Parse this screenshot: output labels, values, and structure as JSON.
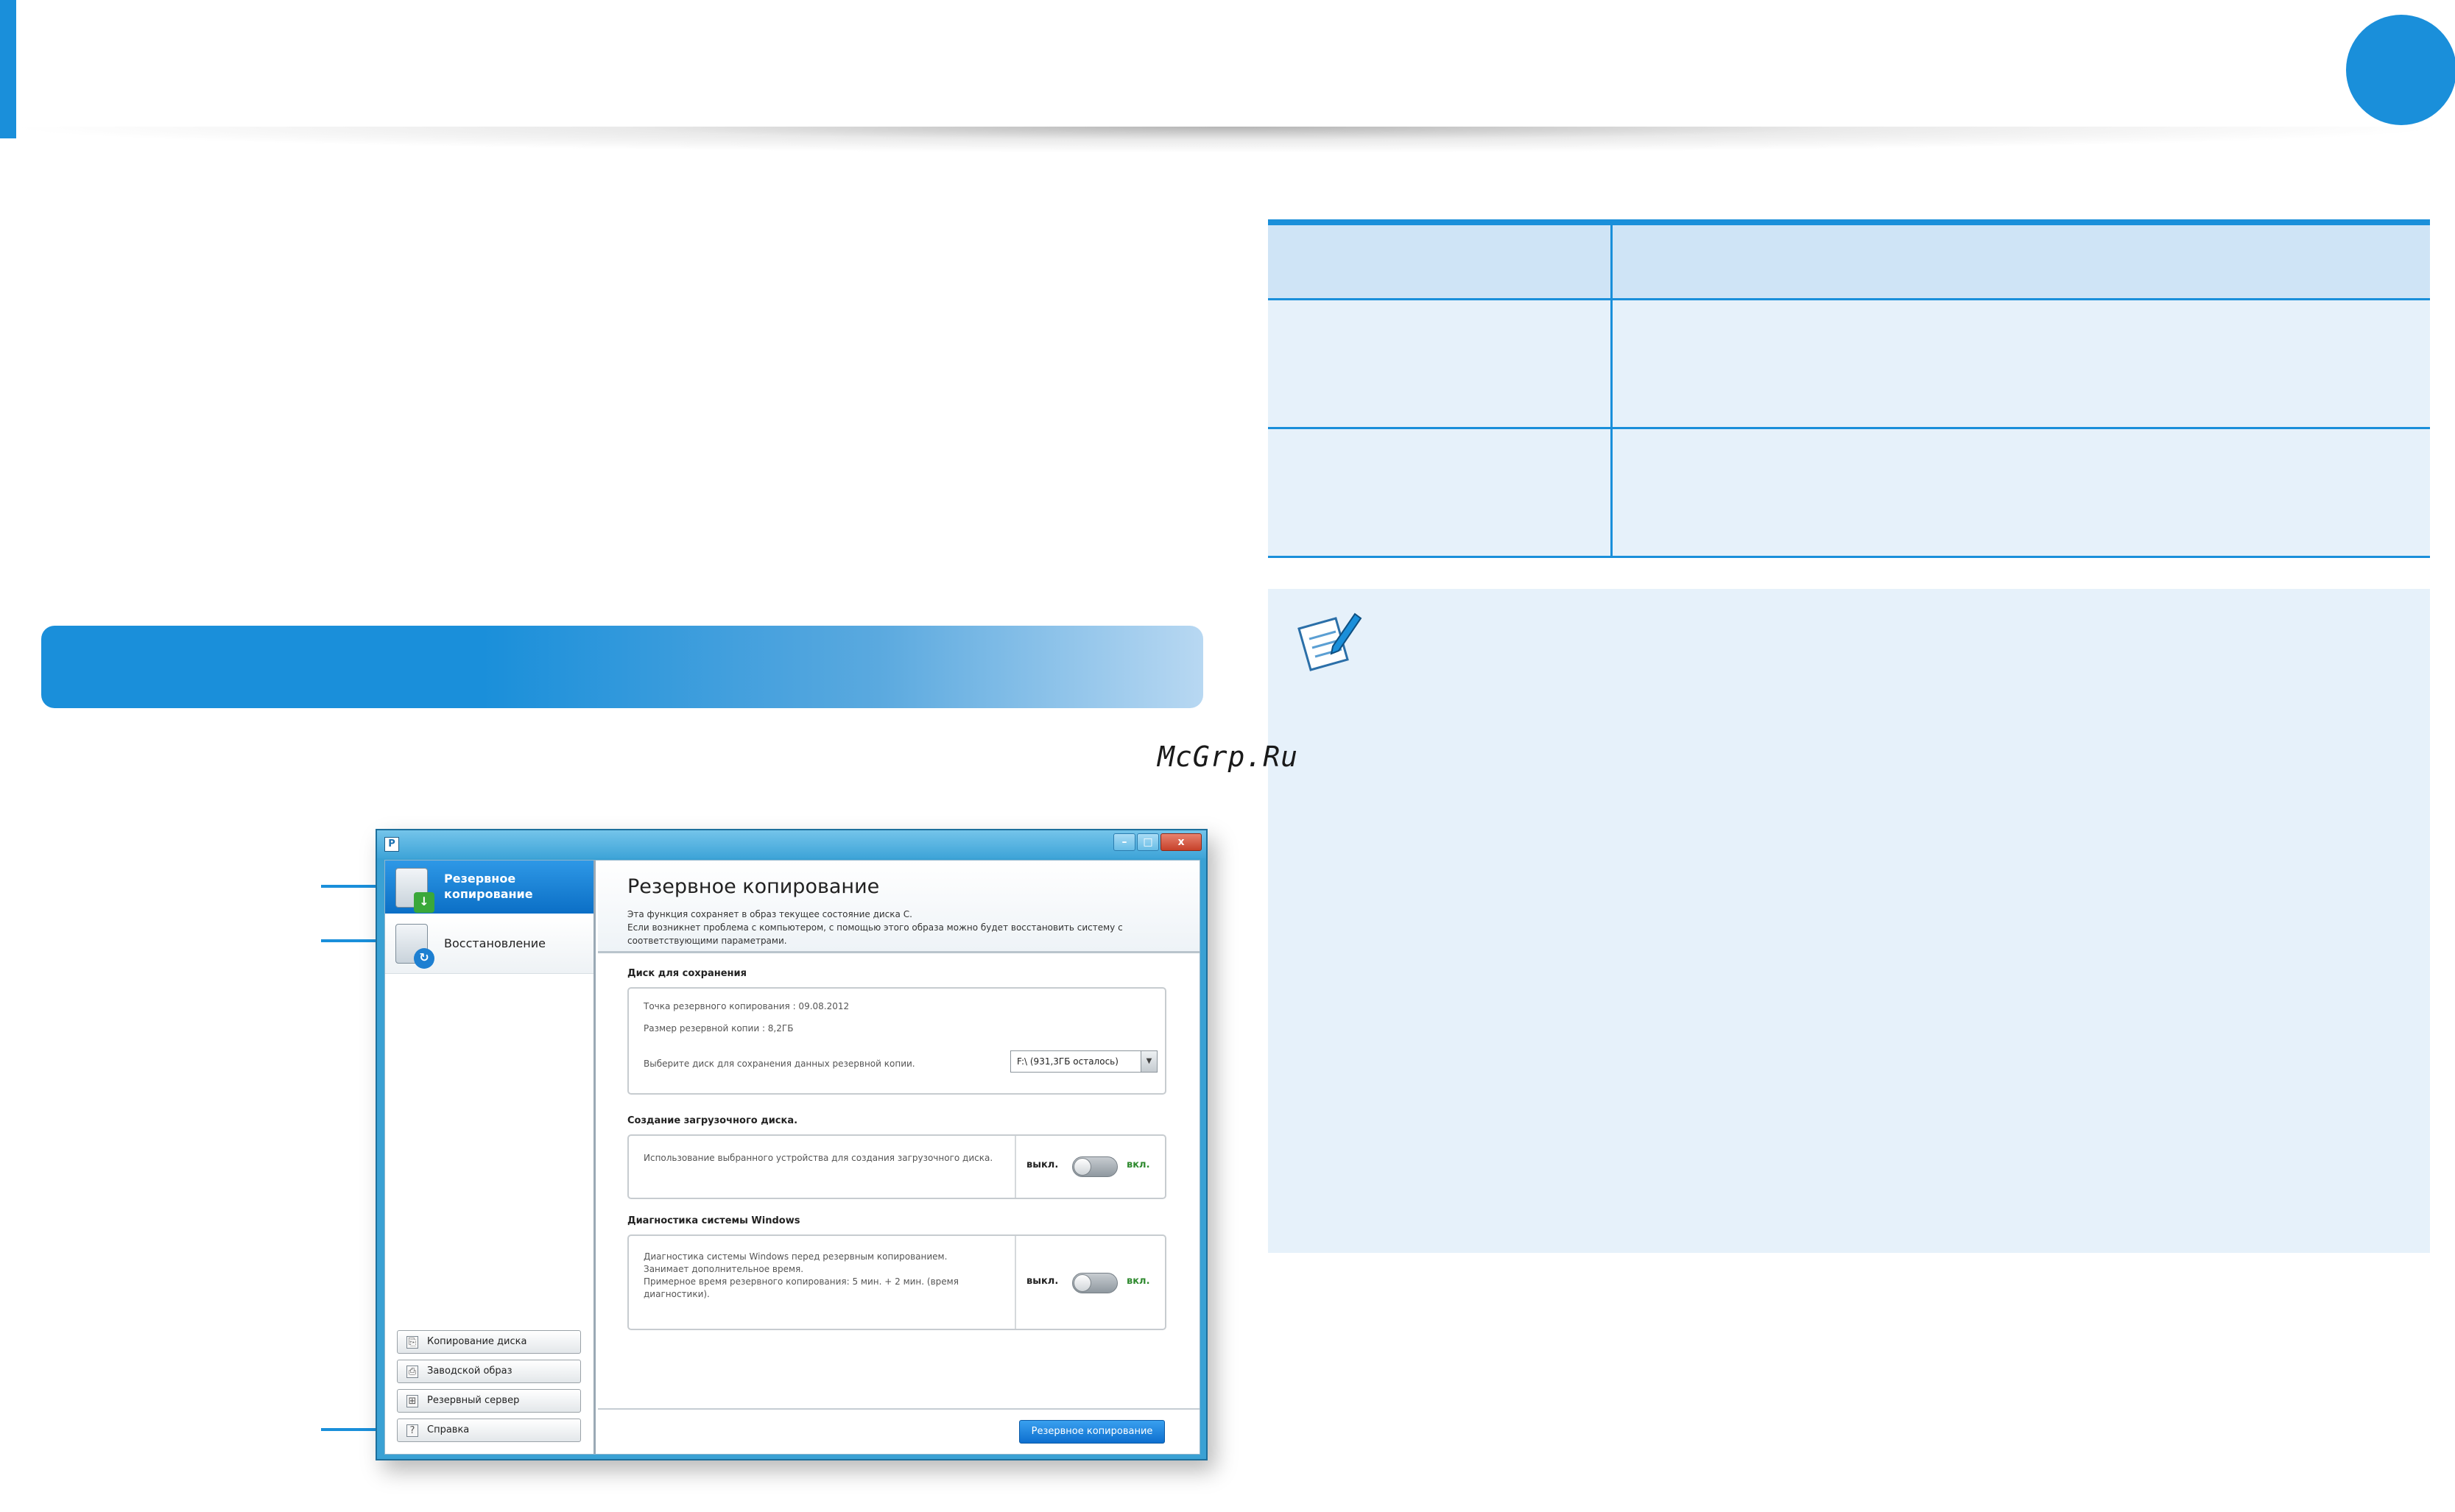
{
  "watermark": "McGrp.Ru",
  "colors": {
    "accent": "#1a8fda",
    "table_head": "#cfe4f6",
    "table_body": "#e6f1fa",
    "window_frame": "#3aa1d4",
    "toggle_on_text": "#2f8a2f"
  },
  "icons": {
    "note": "note-pencil-icon",
    "close": "close-icon",
    "dropdown": "chevron-down-icon"
  },
  "window": {
    "app_icon": "P",
    "controls": {
      "minimize": "–",
      "maximize": "□",
      "close": "x"
    },
    "sidebar": {
      "nav": [
        {
          "label": "Резервное копирование",
          "badge": "↓"
        },
        {
          "label": "Восстановление",
          "badge": "↻"
        }
      ],
      "buttons": [
        {
          "label": "Копирование диска",
          "icon": "⎘"
        },
        {
          "label": "Заводской образ",
          "icon": "⎙"
        },
        {
          "label": "Резервный сервер",
          "icon": "⊞"
        },
        {
          "label": "Справка",
          "icon": "?"
        }
      ]
    },
    "main": {
      "title": "Резервное копирование",
      "description": [
        "Эта функция сохраняет в образ текущее состояние диска C.",
        "Если возникнет проблема с компьютером, с помощью этого образа можно будет восстановить систему с",
        "соответствующими параметрами."
      ],
      "disk_group": {
        "title": "Диск для сохранения",
        "backup_point": "Точка резервного копирования : 09.08.2012",
        "backup_size": "Размер резервной копии : 8,2ГБ",
        "select_prompt": "Выберите диск для сохранения данных резервной копии.",
        "selected_drive": "F:\\ (931,3ГБ осталось)"
      },
      "boot_group": {
        "title": "Создание загрузочного диска.",
        "text": "Использование выбранного устройства для создания загрузочного диска.",
        "off_label": "выкл.",
        "on_label": "вкл."
      },
      "diag_group": {
        "title": "Диагностика системы Windows",
        "lines": [
          "Диагностика системы Windows перед резервным копированием.",
          "Занимает дополнительное время.",
          "Примерное время резервного копирования: 5 мин. + 2 мин. (время",
          "диагностики)."
        ],
        "off_label": "выкл.",
        "on_label": "вкл."
      },
      "primary_button": "Резервное копирование"
    }
  }
}
